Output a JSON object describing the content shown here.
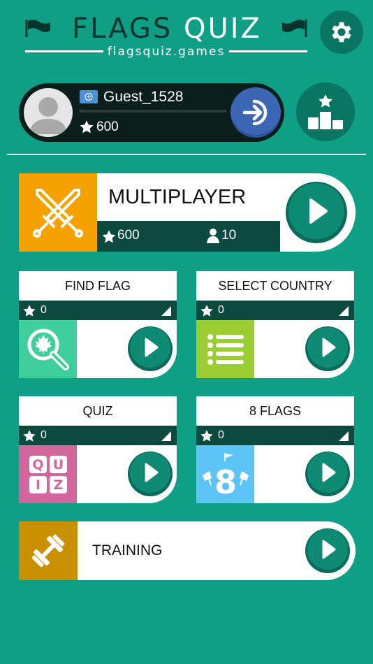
{
  "header": {
    "title_part1": "FLAGS",
    "title_part2": "QUIZ",
    "subtitle": "flagsquiz.games"
  },
  "profile": {
    "username": "Guest_1528",
    "points": "600",
    "progress": 0
  },
  "multiplayer": {
    "title": "MULTIPLAYER",
    "points": "600",
    "players": "10"
  },
  "modes": {
    "find_flag": {
      "title": "FIND FLAG",
      "score": "0"
    },
    "select_country": {
      "title": "SELECT COUNTRY",
      "score": "0"
    },
    "quiz": {
      "title": "QUIZ",
      "score": "0",
      "icon_letters": [
        "Q",
        "U",
        "I",
        "Z"
      ]
    },
    "eight_flags": {
      "title": "8 FLAGS",
      "score": "0",
      "icon_number": "8"
    }
  },
  "training": {
    "title": "TRAINING"
  },
  "colors": {
    "background": "#0f9e86",
    "dark": "#0c4a3f",
    "multiplayer_icon": "#f5a100",
    "find_flag_icon": "#3fcf9c",
    "select_country_icon": "#9acd32",
    "quiz_icon": "#d2679d",
    "eight_flags_icon": "#5cc5f5",
    "training_icon": "#c99000",
    "login_button": "#3d67b6"
  }
}
